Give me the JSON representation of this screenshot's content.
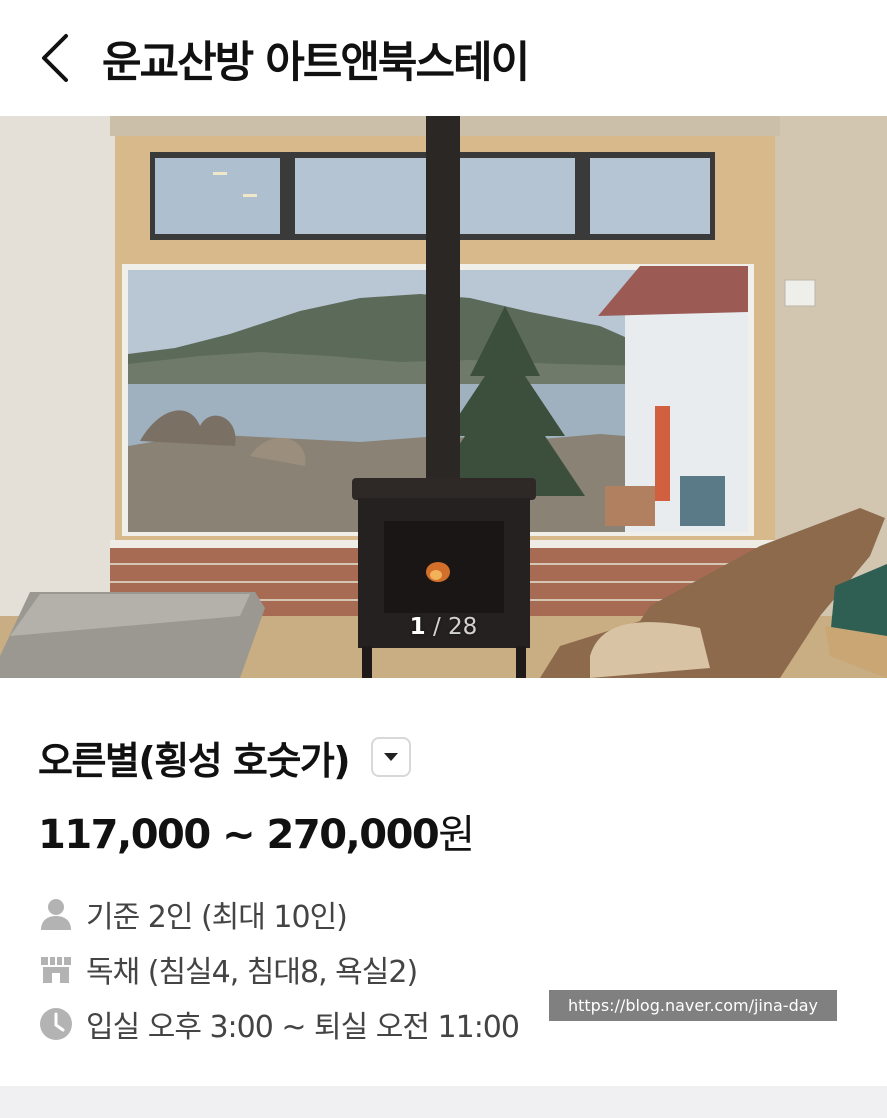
{
  "header": {
    "title": "운교산방 아트앤북스테이"
  },
  "gallery": {
    "current": "1",
    "separator": " / ",
    "total": "28"
  },
  "room": {
    "name": "오른별(횡성 호숫가)"
  },
  "price": {
    "range": "117,000 ~ 270,000",
    "unit": "원"
  },
  "details": {
    "capacity": "기준 2인 (최대 10인)",
    "building": "독채 (침실4, 침대8, 욕실2)",
    "checkin": "입실 오후 3:00 ~ 퇴실 오전 11:00"
  },
  "watermark": {
    "text": "https://blog.naver.com/jina-day"
  },
  "colors": {
    "icon_gray": "#b3b3b3",
    "text_dark": "#111111",
    "text_meta": "#444444",
    "footer_band": "#f0f0f2"
  }
}
